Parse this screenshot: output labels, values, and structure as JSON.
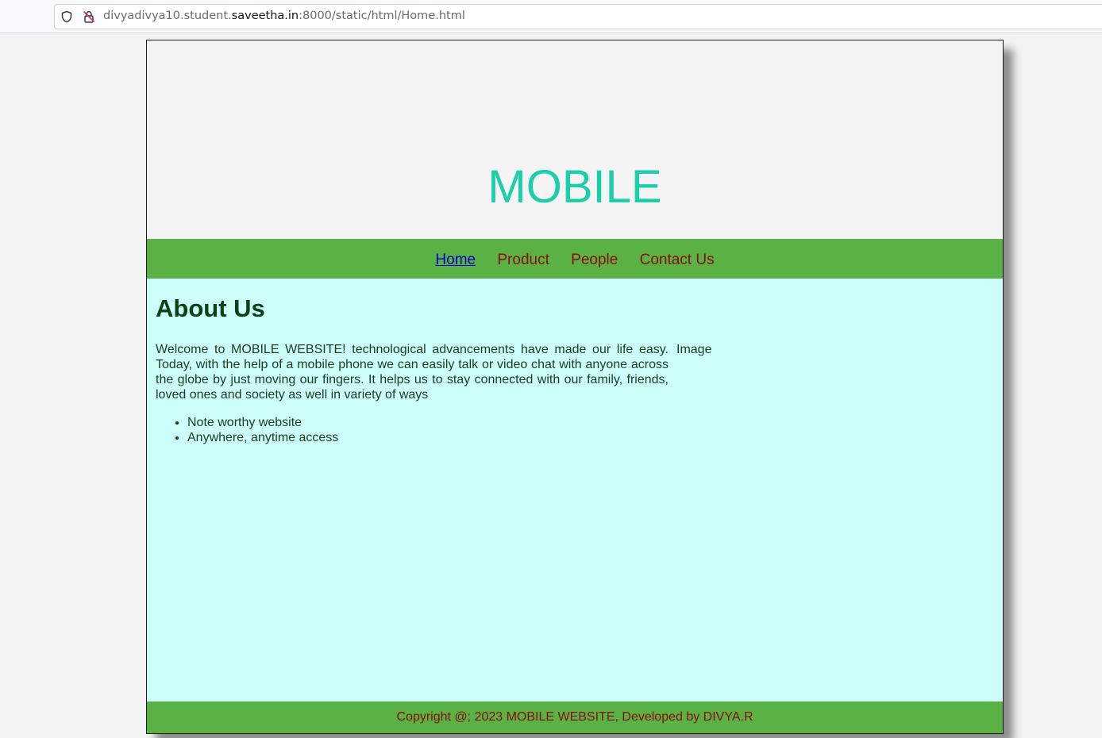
{
  "browser": {
    "url_prefix": "divyadivya10.student.",
    "url_domain": "saveetha.in",
    "url_suffix": ":8000/static/html/Home.html"
  },
  "header": {
    "title": "MOBILE"
  },
  "nav": {
    "items": [
      {
        "label": "Home",
        "active": true
      },
      {
        "label": "Product",
        "active": false
      },
      {
        "label": "People",
        "active": false
      },
      {
        "label": "Contact Us",
        "active": false
      }
    ]
  },
  "main": {
    "heading": "About Us",
    "paragraph": "Welcome to MOBILE WEBSITE! technological advancements have made our life easy. Today, with the help of a mobile phone we can easily talk or video chat with anyone across the globe by just moving our fingers. It helps us to stay connected with our family, friends, loved ones and society as well in variety of ways",
    "image_alt": "Image",
    "features": [
      "Note worthy website",
      "Anywhere, anytime access"
    ]
  },
  "footer": {
    "text": "Copyright @; 2023 MOBILE WEBSITE, Developed by DIVYA.R"
  },
  "colors": {
    "title": "#1ccfab",
    "nav_bg": "#5ab144",
    "nav_link": "#8b0d0d",
    "content_bg": "#ccfffa",
    "heading": "#0c4017"
  },
  "icons": [
    "shield-icon",
    "insecure-lock-icon"
  ]
}
